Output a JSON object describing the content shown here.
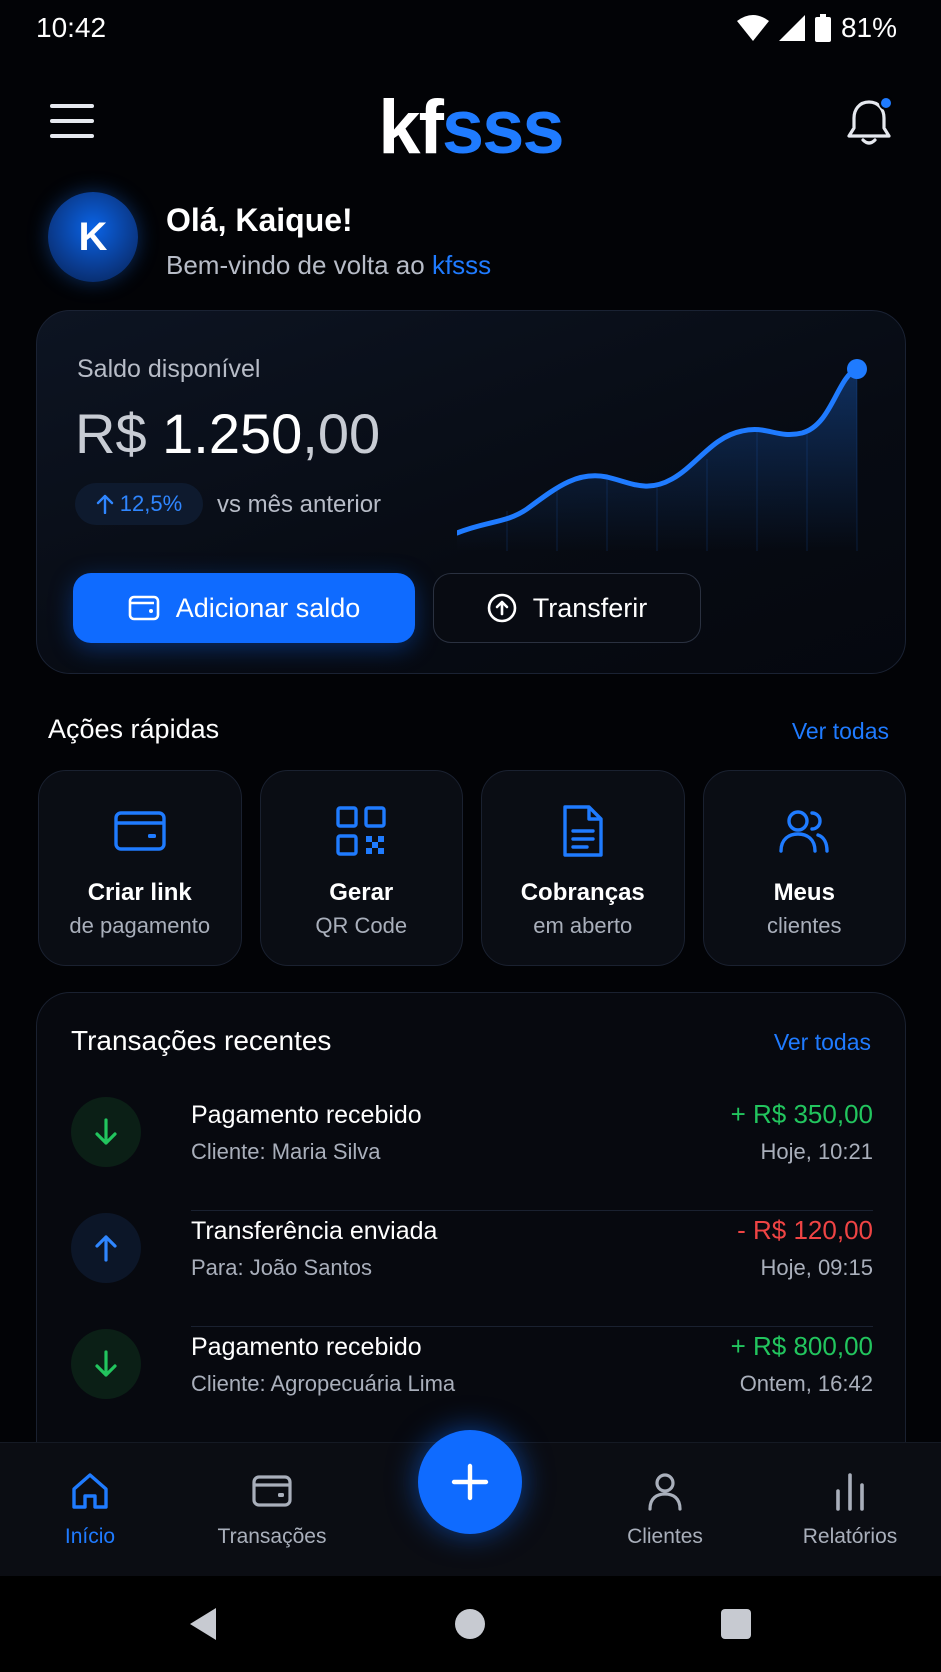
{
  "status_bar": {
    "time": "10:42",
    "battery": "81%"
  },
  "header": {
    "logo_part1": "kf",
    "logo_part2": "sss"
  },
  "greeting": {
    "avatar_letter": "K",
    "hello": "Olá, Kaique!",
    "welcome_prefix": "Bem-vindo de volta ao ",
    "brand": "kfsss"
  },
  "balance": {
    "label": "Saldo disponível",
    "currency": "R$ ",
    "amount_integer": "1.250",
    "amount_cents": ",00",
    "change": "12,5%",
    "change_caption": "vs mês anterior",
    "add_button": "Adicionar saldo",
    "transfer_button": "Transferir"
  },
  "quick_actions": {
    "title": "Ações rápidas",
    "see_all": "Ver todas",
    "items": [
      {
        "line1": "Criar link",
        "line2": "de pagamento",
        "icon": "card-icon"
      },
      {
        "line1": "Gerar",
        "line2": "QR Code",
        "icon": "qr-code-icon"
      },
      {
        "line1": "Cobranças",
        "line2": "em aberto",
        "icon": "document-icon"
      },
      {
        "line1": "Meus",
        "line2": "clientes",
        "icon": "users-icon"
      }
    ]
  },
  "transactions": {
    "title": "Transações recentes",
    "see_all": "Ver todas",
    "items": [
      {
        "name": "Pagamento recebido",
        "detail": "Cliente: Maria Silva",
        "amount": "+ R$ 350,00",
        "time": "Hoje, 10:21",
        "direction": "in"
      },
      {
        "name": "Transferência enviada",
        "detail": "Para: João Santos",
        "amount": "- R$ 120,00",
        "time": "Hoje, 09:15",
        "direction": "out"
      },
      {
        "name": "Pagamento recebido",
        "detail": "Cliente: Agropecuária Lima",
        "amount": "+ R$ 800,00",
        "time": "Ontem, 16:42",
        "direction": "in"
      }
    ]
  },
  "bottom_nav": {
    "items": [
      {
        "label": "Início",
        "icon": "home-icon",
        "active": true
      },
      {
        "label": "Transações",
        "icon": "wallet-icon"
      },
      {
        "label": "Clientes",
        "icon": "user-icon"
      },
      {
        "label": "Relatórios",
        "icon": "bar-chart-icon"
      }
    ]
  },
  "colors": {
    "accent": "#1f7bff",
    "positive": "#22c55e",
    "negative": "#ef4444",
    "background": "#020306"
  }
}
